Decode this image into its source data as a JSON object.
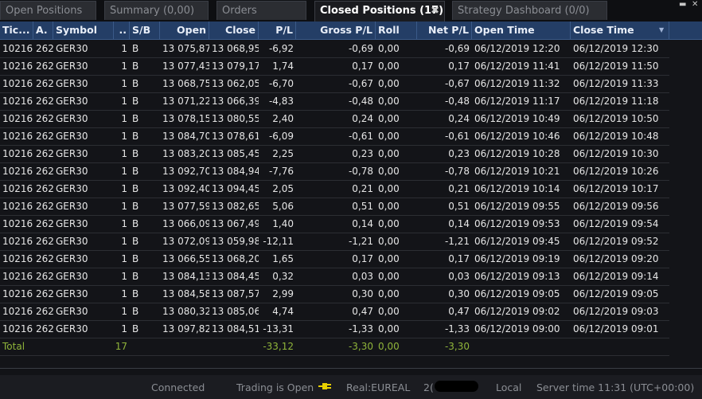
{
  "tabs": [
    {
      "label": "Open Positions"
    },
    {
      "label": "Summary (0,00)"
    },
    {
      "label": "Orders"
    },
    {
      "label": "Closed Positions (17)"
    },
    {
      "label": "Strategy Dashboard (0/0)"
    }
  ],
  "window_controls": {
    "minimize": "▬",
    "close": "✕"
  },
  "columns": [
    "Tic...",
    "A.",
    "Symbol",
    "..",
    "S/B",
    "Open",
    "Close",
    "P/L",
    "Gross P/L",
    "Roll",
    "Net P/L",
    "Open Time",
    "Close Time"
  ],
  "rows": [
    [
      "10216",
      "262",
      "GER30",
      "1",
      "B",
      "13 075,87",
      "13 068,95",
      "-6,92",
      "-0,69",
      "0,00",
      "-0,69",
      "06/12/2019 12:20",
      "06/12/2019 12:30"
    ],
    [
      "10216",
      "262",
      "GER30",
      "1",
      "B",
      "13 077,43",
      "13 079,17",
      "1,74",
      "0,17",
      "0,00",
      "0,17",
      "06/12/2019 11:41",
      "06/12/2019 11:50"
    ],
    [
      "10216",
      "262",
      "GER30",
      "1",
      "B",
      "13 068,75",
      "13 062,05",
      "-6,70",
      "-0,67",
      "0,00",
      "-0,67",
      "06/12/2019 11:32",
      "06/12/2019 11:33"
    ],
    [
      "10216",
      "262",
      "GER30",
      "1",
      "B",
      "13 071,22",
      "13 066,39",
      "-4,83",
      "-0,48",
      "0,00",
      "-0,48",
      "06/12/2019 11:17",
      "06/12/2019 11:18"
    ],
    [
      "10216",
      "262",
      "GER30",
      "1",
      "B",
      "13 078,15",
      "13 080,55",
      "2,40",
      "0,24",
      "0,00",
      "0,24",
      "06/12/2019 10:49",
      "06/12/2019 10:50"
    ],
    [
      "10216",
      "262",
      "GER30",
      "1",
      "B",
      "13 084,70",
      "13 078,61",
      "-6,09",
      "-0,61",
      "0,00",
      "-0,61",
      "06/12/2019 10:46",
      "06/12/2019 10:48"
    ],
    [
      "10216",
      "262",
      "GER30",
      "1",
      "B",
      "13 083,20",
      "13 085,45",
      "2,25",
      "0,23",
      "0,00",
      "0,23",
      "06/12/2019 10:28",
      "06/12/2019 10:30"
    ],
    [
      "10216",
      "262",
      "GER30",
      "1",
      "B",
      "13 092,70",
      "13 084,94",
      "-7,76",
      "-0,78",
      "0,00",
      "-0,78",
      "06/12/2019 10:21",
      "06/12/2019 10:26"
    ],
    [
      "10216",
      "262",
      "GER30",
      "1",
      "B",
      "13 092,40",
      "13 094,45",
      "2,05",
      "0,21",
      "0,00",
      "0,21",
      "06/12/2019 10:14",
      "06/12/2019 10:17"
    ],
    [
      "10216",
      "262",
      "GER30",
      "1",
      "B",
      "13 077,59",
      "13 082,65",
      "5,06",
      "0,51",
      "0,00",
      "0,51",
      "06/12/2019 09:55",
      "06/12/2019 09:56"
    ],
    [
      "10216",
      "262",
      "GER30",
      "1",
      "B",
      "13 066,09",
      "13 067,49",
      "1,40",
      "0,14",
      "0,00",
      "0,14",
      "06/12/2019 09:53",
      "06/12/2019 09:54"
    ],
    [
      "10216",
      "262",
      "GER30",
      "1",
      "B",
      "13 072,09",
      "13 059,98",
      "-12,11",
      "-1,21",
      "0,00",
      "-1,21",
      "06/12/2019 09:45",
      "06/12/2019 09:52"
    ],
    [
      "10216",
      "262",
      "GER30",
      "1",
      "B",
      "13 066,55",
      "13 068,20",
      "1,65",
      "0,17",
      "0,00",
      "0,17",
      "06/12/2019 09:19",
      "06/12/2019 09:20"
    ],
    [
      "10216",
      "262",
      "GER30",
      "1",
      "B",
      "13 084,13",
      "13 084,45",
      "0,32",
      "0,03",
      "0,00",
      "0,03",
      "06/12/2019 09:13",
      "06/12/2019 09:14"
    ],
    [
      "10216",
      "262",
      "GER30",
      "1",
      "B",
      "13 084,58",
      "13 087,57",
      "2,99",
      "0,30",
      "0,00",
      "0,30",
      "06/12/2019 09:05",
      "06/12/2019 09:05"
    ],
    [
      "10216",
      "262",
      "GER30",
      "1",
      "B",
      "13 080,32",
      "13 085,06",
      "4,74",
      "0,47",
      "0,00",
      "0,47",
      "06/12/2019 09:02",
      "06/12/2019 09:03"
    ],
    [
      "10216",
      "262",
      "GER30",
      "1",
      "B",
      "13 097,82",
      "13 084,51",
      "-13,31",
      "-1,33",
      "0,00",
      "-1,33",
      "06/12/2019 09:00",
      "06/12/2019 09:01"
    ]
  ],
  "total": {
    "label": "Total",
    "count": "17",
    "pl": "-33,12",
    "gross": "-3,30",
    "roll": "0,00",
    "net": "-3,30"
  },
  "status": {
    "connected": "Connected",
    "trading": "Trading is Open",
    "account": "Real:EUREAL",
    "account_id_prefix": "2(",
    "locale": "Local",
    "server_time": "Server time 11:31 (UTC+00:00)"
  },
  "colors": {
    "header": "#243e66",
    "accent_total": "#8fb43a",
    "plug_icon": "#e8d000"
  }
}
